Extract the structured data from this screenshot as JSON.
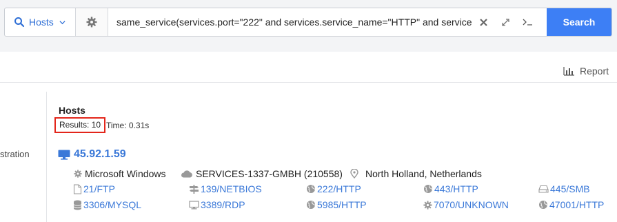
{
  "search": {
    "scope_label": "Hosts",
    "query": "same_service(services.port=\"222\" and services.service_name=\"HTTP\" and services",
    "button_label": "Search"
  },
  "toolbar": {
    "report_label": "Report"
  },
  "sidebar": {
    "partial_item": "stration"
  },
  "results": {
    "title": "Hosts",
    "count_text": "Results: 10",
    "time_text": "Time: 0.31s",
    "hosts": [
      {
        "ip": "45.92.1.59",
        "os": "Microsoft Windows",
        "asn": "SERVICES-1337-GMBH (210558)",
        "location": "North Holland, Netherlands",
        "services": [
          {
            "label": "21/FTP",
            "icon": "file-icon"
          },
          {
            "label": "139/NETBIOS",
            "icon": "signpost-icon"
          },
          {
            "label": "222/HTTP",
            "icon": "globe-icon"
          },
          {
            "label": "443/HTTP",
            "icon": "globe-icon"
          },
          {
            "label": "445/SMB",
            "icon": "drive-icon"
          },
          {
            "label": "3306/MYSQL",
            "icon": "database-icon"
          },
          {
            "label": "3389/RDP",
            "icon": "monitor-icon"
          },
          {
            "label": "5985/HTTP",
            "icon": "globe-icon"
          },
          {
            "label": "7070/UNKNOWN",
            "icon": "gear-icon"
          },
          {
            "label": "47001/HTTP",
            "icon": "globe-icon"
          }
        ]
      }
    ]
  },
  "colors": {
    "accent": "#3d7ff5",
    "link": "#3a78d8",
    "highlight": "#e3261b"
  }
}
